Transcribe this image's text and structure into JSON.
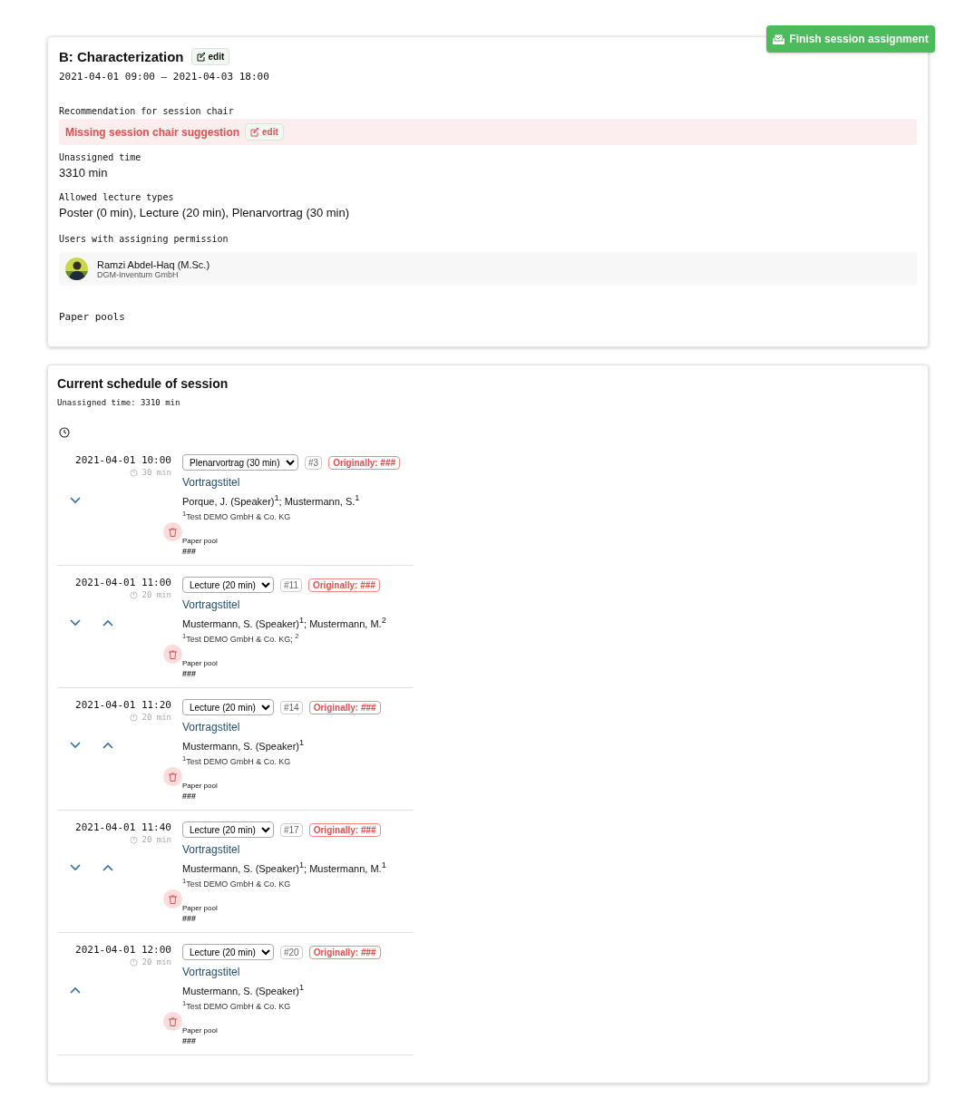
{
  "finish_button": {
    "label": "Finish session assignment"
  },
  "session": {
    "title": "B: Characterization",
    "edit_label": "edit",
    "time_range": "2021-04-01 09:00 – 2021-04-03 18:00",
    "chair_label": "Recommendation for session chair",
    "chair_missing": "Missing session chair suggestion",
    "chair_edit_label": "edit",
    "unassigned_label": "Unassigned time",
    "unassigned_value": "3310 min",
    "types_label": "Allowed lecture types",
    "types_value": "Poster (0 min), Lecture (20 min), Plenarvortrag (30 min)",
    "users_label": "Users with assigning permission",
    "users": [
      {
        "name": "Ramzi Abdel-Haq (M.Sc.)",
        "org": "DGM-Inventum GmbH"
      }
    ],
    "pools_label": "Paper pools"
  },
  "schedule": {
    "title": "Current schedule of session",
    "unassigned": "Unassigned time: 3310 min",
    "slots": [
      {
        "time": "2021-04-01 10:00",
        "duration": "30 min",
        "can_move_down": true,
        "can_move_up": false,
        "type": "Plenarvortrag (30 min)",
        "number": "#3",
        "original": "Originally: ###",
        "title": "Vortragstitel",
        "authors": "Porque, J. (Speaker)$^{1}$; Mustermann, S.$^{1}$",
        "affiliations": "$^{1}$Test DEMO GmbH & Co. KG",
        "pool_label": "Paper pool",
        "pool": "###"
      },
      {
        "time": "2021-04-01 11:00",
        "duration": "20 min",
        "can_move_down": true,
        "can_move_up": true,
        "type": "Lecture (20 min)",
        "number": "#11",
        "original": "Originally: ###",
        "title": "Vortragstitel",
        "authors": "Mustermann, S. (Speaker)$^{1}$; Mustermann, M.$^{2}$",
        "affiliations": "$^{1}$Test DEMO GmbH & Co. KG; $^{2}$",
        "pool_label": "Paper pool",
        "pool": "###"
      },
      {
        "time": "2021-04-01 11:20",
        "duration": "20 min",
        "can_move_down": true,
        "can_move_up": true,
        "type": "Lecture (20 min)",
        "number": "#14",
        "original": "Originally: ###",
        "title": "Vortragstitel",
        "authors": "Mustermann, S. (Speaker)$^{1}$",
        "affiliations": "$^{1}$Test DEMO GmbH & Co. KG",
        "pool_label": "Paper pool",
        "pool": "###"
      },
      {
        "time": "2021-04-01 11:40",
        "duration": "20 min",
        "can_move_down": true,
        "can_move_up": true,
        "type": "Lecture (20 min)",
        "number": "#17",
        "original": "Originally: ###",
        "title": "Vortragstitel",
        "authors": "Mustermann, S. (Speaker)$^{1}$; Mustermann, M.$^{1}$",
        "affiliations": "$^{1}$Test DEMO GmbH & Co. KG",
        "pool_label": "Paper pool",
        "pool": "###"
      },
      {
        "time": "2021-04-01 12:00",
        "duration": "20 min",
        "can_move_down": false,
        "can_move_up": true,
        "type": "Lecture (20 min)",
        "number": "#20",
        "original": "Originally: ###",
        "title": "Vortragstitel",
        "authors": "Mustermann, S. (Speaker)$^{1}$",
        "affiliations": "$^{1}$Test DEMO GmbH & Co. KG",
        "pool_label": "Paper pool",
        "pool": "###"
      }
    ]
  }
}
